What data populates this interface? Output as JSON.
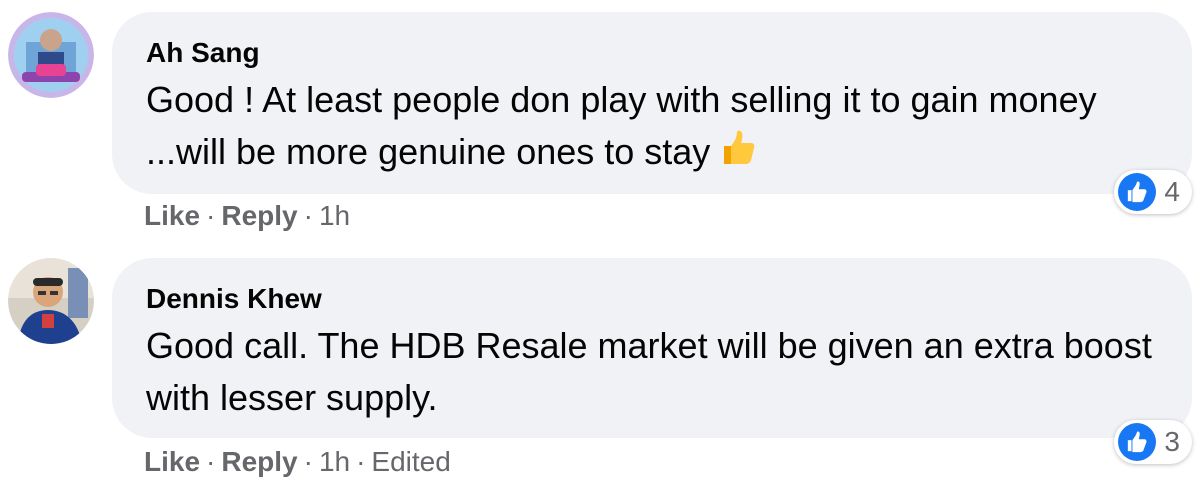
{
  "comments": [
    {
      "author": "Ah Sang",
      "text": "Good ! At least people don play with selling it to gain money ...will be more genuine ones to stay",
      "reaction_count": "4",
      "like_label": "Like",
      "reply_label": "Reply",
      "separator": "·",
      "time": "1h",
      "edited": ""
    },
    {
      "author": "Dennis Khew",
      "text": "Good call. The HDB Resale market will be given an extra boost with lesser supply.",
      "reaction_count": "3",
      "like_label": "Like",
      "reply_label": "Reply",
      "separator": "·",
      "time": "1h",
      "edited": "Edited"
    }
  ],
  "icons": {
    "reaction": "like-thumbs-up-icon",
    "emoji": "thumbs-up-emoji-icon"
  },
  "colors": {
    "bubble": "#f0f2f5",
    "reaction_blue": "#1877f2",
    "meta_text": "#65676b"
  }
}
